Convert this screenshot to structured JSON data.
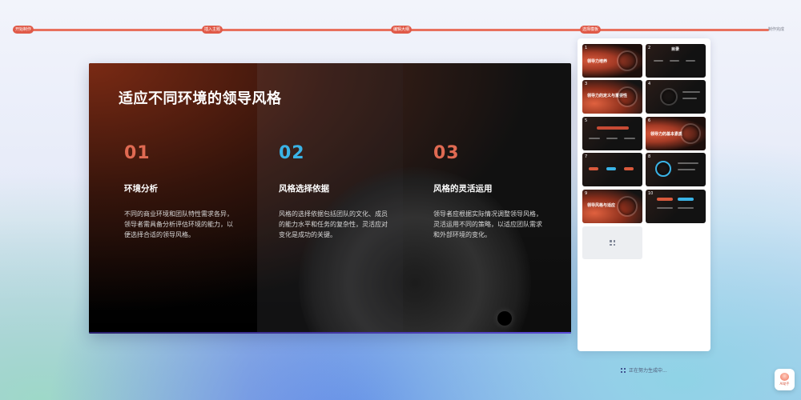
{
  "progress": {
    "steps": [
      "开始制作",
      "插入主题",
      "编辑大纲",
      "选择模板"
    ],
    "end_label": "制作完成",
    "accent": "#e05a48"
  },
  "slide": {
    "title": "适应不同环境的领导风格",
    "columns": [
      {
        "number": "01",
        "heading": "环境分析",
        "body": "不同的商业环境和团队特性需求各异，领导者需具备分析评估环境的能力，以便选择合适的领导风格。",
        "number_color": "#e06a52"
      },
      {
        "number": "02",
        "heading": "风格选择依据",
        "body": "风格的选择依据包括团队的文化、成员的能力水平和任务的复杂性，灵活应对变化是成功的关键。",
        "number_color": "#3ab3e6"
      },
      {
        "number": "03",
        "heading": "风格的灵活运用",
        "body": "领导者应根据实际情况调整领导风格，灵活运用不同的策略，以适应团队需求和外部环境的变化。",
        "number_color": "#e06a52"
      }
    ]
  },
  "thumbnails": [
    {
      "num": "1",
      "title": "领导力培养"
    },
    {
      "num": "2",
      "title": "目录"
    },
    {
      "num": "3",
      "title": "领导力的定义与重要性"
    },
    {
      "num": "4",
      "title": ""
    },
    {
      "num": "5",
      "title": ""
    },
    {
      "num": "6",
      "title": "领导力的基本素质"
    },
    {
      "num": "7",
      "title": ""
    },
    {
      "num": "8",
      "title": ""
    },
    {
      "num": "9",
      "title": "领导风格与适应"
    },
    {
      "num": "10",
      "title": ""
    }
  ],
  "status": {
    "text": "正在努力生成中...",
    "icon": "grid-icon"
  },
  "helper": {
    "label": "AI助手",
    "icon": "assistant-avatar-icon"
  }
}
